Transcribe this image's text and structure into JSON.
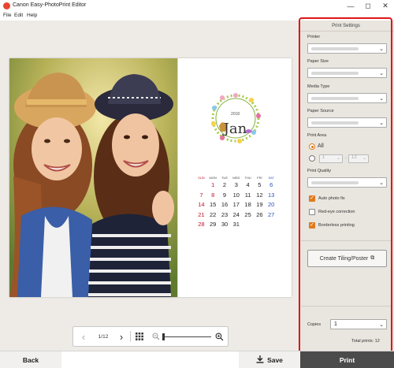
{
  "window": {
    "title": "Canon Easy-PhotoPrint Editor"
  },
  "menu": [
    "File",
    "Edit",
    "Help"
  ],
  "calendar": {
    "year": "2018",
    "month": "Jan",
    "weekdays": [
      "SUN",
      "MON",
      "TUE",
      "WED",
      "THU",
      "FRI",
      "SAT"
    ],
    "weeks": [
      [
        "",
        "1",
        "2",
        "3",
        "4",
        "5",
        "6"
      ],
      [
        "7",
        "8",
        "9",
        "10",
        "11",
        "12",
        "13"
      ],
      [
        "14",
        "15",
        "16",
        "17",
        "18",
        "19",
        "20"
      ],
      [
        "21",
        "22",
        "23",
        "24",
        "25",
        "26",
        "27"
      ],
      [
        "28",
        "29",
        "30",
        "31",
        "",
        "",
        ""
      ]
    ]
  },
  "navigation": {
    "page_indicator": "1/12"
  },
  "print_settings": {
    "title": "Print Settings",
    "printer_label": "Printer",
    "paper_size_label": "Paper Size",
    "media_type_label": "Media Type",
    "paper_source_label": "Paper Source",
    "print_area_label": "Print Area",
    "print_area_all": "All",
    "range_from": "1",
    "range_to": "12",
    "print_quality_label": "Print Quality",
    "auto_photo_fix": "Auto photo fix",
    "auto_photo_fix_checked": true,
    "red_eye_correction": "Red-eye correction",
    "red_eye_checked": false,
    "borderless_printing": "Borderless printing",
    "borderless_checked": true,
    "tiling_button": "Create Tiling/Poster",
    "copies_label": "Copies",
    "copies_value": "1",
    "total_prints": "Total prints: 12"
  },
  "bottom": {
    "back": "Back",
    "save": "Save",
    "print": "Print"
  },
  "colors": {
    "accent": "#e07b1e",
    "highlight_outline": "#e0161a",
    "print_button": "#4b4b4b",
    "sunday": "#c0162a",
    "saturday": "#2f50b8"
  }
}
